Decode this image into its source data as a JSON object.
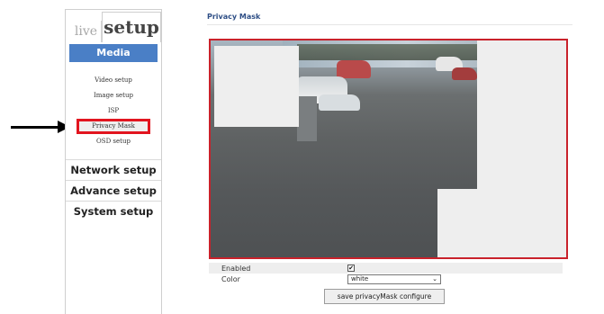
{
  "sidebar": {
    "tab_live": "live",
    "tab_setup": "setup",
    "media_header": "Media",
    "media_items": [
      {
        "label": "Video setup"
      },
      {
        "label": "Image setup"
      },
      {
        "label": "ISP"
      },
      {
        "label": "Privacy Mask",
        "active": true
      },
      {
        "label": "OSD setup"
      }
    ],
    "sections": [
      "Network setup",
      "Advance setup",
      "System setup"
    ]
  },
  "main": {
    "title": "Privacy Mask",
    "enabled_label": "Enabled",
    "enabled_checked": true,
    "enabled_mark": "✔",
    "color_label": "Color",
    "color_value": "white",
    "save_button": "save privacyMask configure"
  },
  "icons": {
    "annotation_arrow": "arrow-right-icon",
    "select_chevron": "chevron-down-icon"
  },
  "colors": {
    "accent": "#4a7fc6",
    "highlight": "#e2151f",
    "title": "#2f4f86",
    "mask": "#eeeeee"
  }
}
